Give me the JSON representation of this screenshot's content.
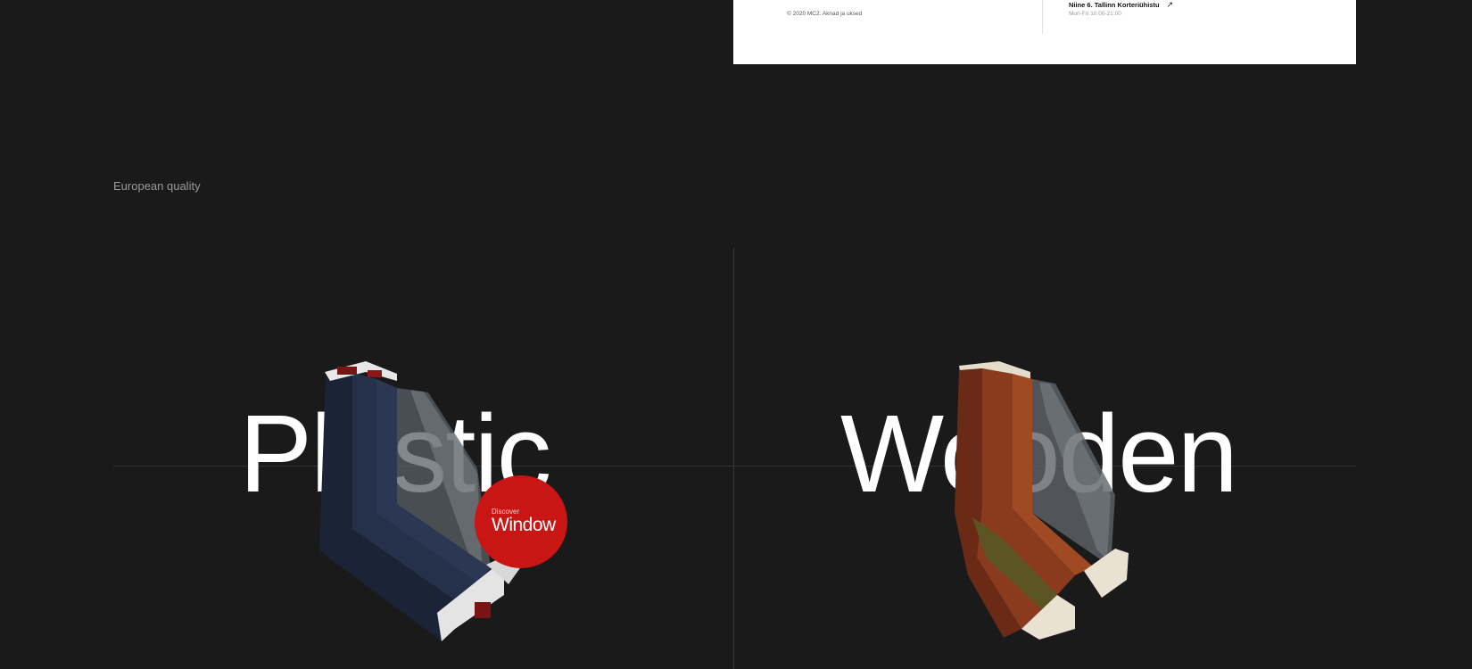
{
  "footer": {
    "copyright": "© 2020 MC2. Aknad ja uksed",
    "address": "Niine 6. Tallinn Korteriühistu",
    "hours": "Mon-Fri 10:00-21:00",
    "link_icon": "arrow-up-right-icon"
  },
  "tagline": "European quality",
  "categories": [
    {
      "word": "Plastic",
      "image": "plastic-window-profile"
    },
    {
      "word": "Wooden",
      "image": "wooden-window-profile"
    }
  ],
  "cta": {
    "small": "Discover",
    "large": "Window",
    "color": "#c91614"
  },
  "colors": {
    "background": "#1a1a1a",
    "card": "#ffffff",
    "accent": "#c91614"
  }
}
